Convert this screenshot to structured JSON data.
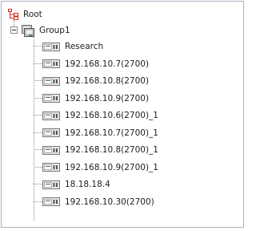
{
  "tree": {
    "root": {
      "label": "Root",
      "icon": "network-root-icon",
      "expanded": true
    },
    "group": {
      "label": "Group1",
      "icon": "device-group-icon",
      "expanded": true
    },
    "devices": [
      {
        "label": "Research",
        "icon": "device-icon"
      },
      {
        "label": "192.168.10.7(2700)",
        "icon": "device-icon"
      },
      {
        "label": "192.168.10.8(2700)",
        "icon": "device-icon"
      },
      {
        "label": "192.168.10.9(2700)",
        "icon": "device-icon"
      },
      {
        "label": "192.168.10.6(2700)_1",
        "icon": "device-icon"
      },
      {
        "label": "192.168.10.7(2700)_1",
        "icon": "device-icon"
      },
      {
        "label": "192.168.10.8(2700)_1",
        "icon": "device-icon"
      },
      {
        "label": "192.168.10.9(2700)_1",
        "icon": "device-icon"
      },
      {
        "label": "18.18.18.4",
        "icon": "device-icon"
      },
      {
        "label": "192.168.10.30(2700)",
        "icon": "device-icon"
      }
    ]
  },
  "colors": {
    "root_red": "#d03020",
    "device_green": "#2e8b2e",
    "tree_line": "#8e8e8e",
    "panel_border": "#a9b4c2"
  }
}
